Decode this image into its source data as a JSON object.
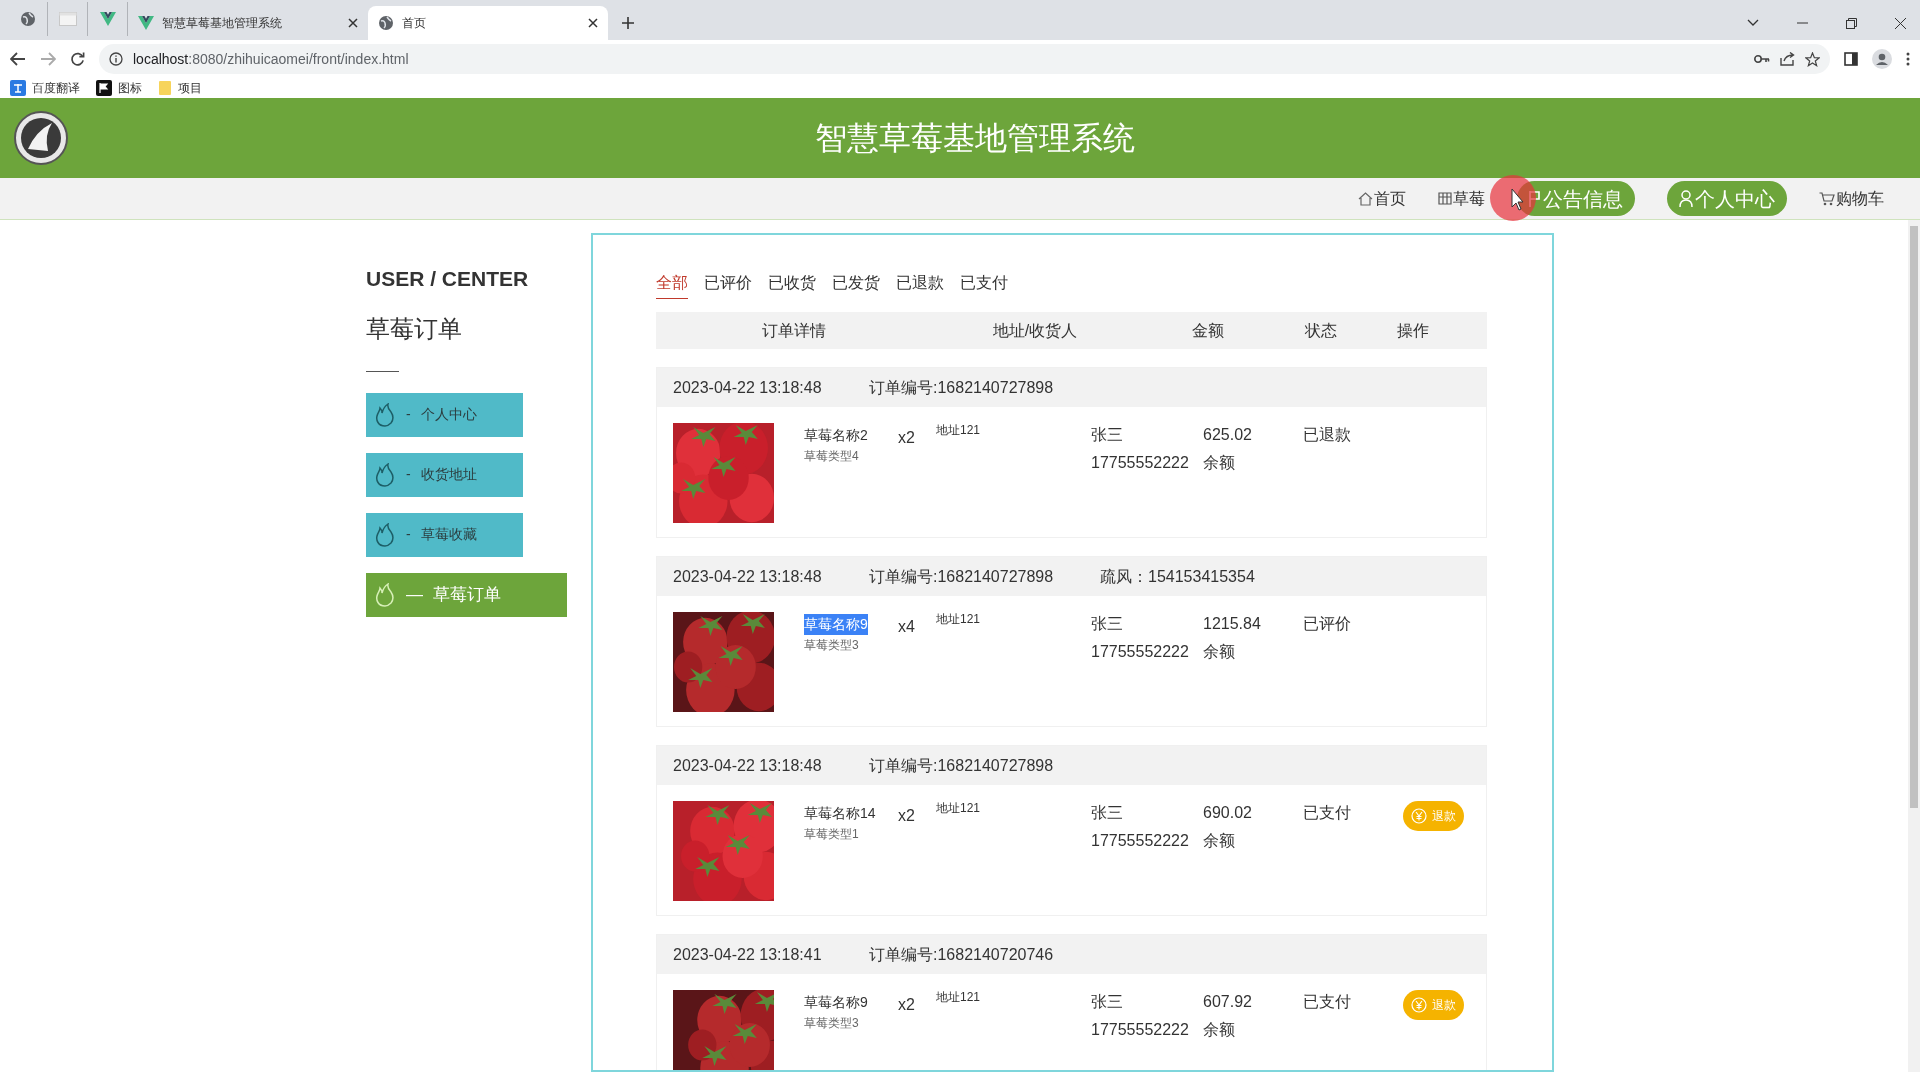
{
  "browser": {
    "tabs": [
      {
        "kind": "icon"
      },
      {
        "kind": "icon"
      },
      {
        "kind": "icon"
      },
      {
        "kind": "page",
        "title": "智慧草莓基地管理系统",
        "selected": false
      },
      {
        "kind": "page",
        "title": "首页",
        "selected": true
      }
    ],
    "url_host": "localhost",
    "url_path": ":8080/zhihuicaomei/front/index.html",
    "bookmarks": [
      "百度翻译",
      "图标",
      "项目"
    ]
  },
  "header": {
    "title": "智慧草莓基地管理系统"
  },
  "nav": [
    {
      "label": "首页",
      "highlighted": false
    },
    {
      "label": "草莓",
      "highlighted": false
    },
    {
      "label": "公告信息",
      "highlighted": true
    },
    {
      "label": "个人中心",
      "highlighted": true
    },
    {
      "label": "购物车",
      "highlighted": false
    }
  ],
  "sidebar": {
    "heading": "USER / CENTER",
    "title": "草莓订单",
    "items": [
      {
        "prefix": "-",
        "label": "个人中心",
        "selected": false
      },
      {
        "prefix": "-",
        "label": "收货地址",
        "selected": false
      },
      {
        "prefix": "-",
        "label": "草莓收藏",
        "selected": false
      },
      {
        "prefix": "—",
        "label": "草莓订单",
        "selected": true
      }
    ]
  },
  "filter_tabs": [
    {
      "label": "全部",
      "selected": true
    },
    {
      "label": "已评价",
      "selected": false
    },
    {
      "label": "已收货",
      "selected": false
    },
    {
      "label": "已发货",
      "selected": false
    },
    {
      "label": "已退款",
      "selected": false
    },
    {
      "label": "已支付",
      "selected": false
    }
  ],
  "columns": [
    "订单详情",
    "地址/收货人",
    "金额",
    "状态",
    "操作"
  ],
  "orders": [
    {
      "time": "2023-04-22 13:18:48",
      "order_no": "订单编号:1682140727898",
      "product": "草莓名称2",
      "highlighted": false,
      "type": "草莓类型4",
      "qty": "x2",
      "address": "地址121",
      "receiver": "张三",
      "phone": "17755552222",
      "amount": "625.02",
      "payment": "余额",
      "status": "已退款"
    },
    {
      "time": "2023-04-22 13:18:48",
      "order_no": "订单编号:1682140727898",
      "extra": "疏风：154153415354",
      "product": "草莓名称9",
      "highlighted": true,
      "type": "草莓类型3",
      "qty": "x4",
      "address": "地址121",
      "receiver": "张三",
      "phone": "17755552222",
      "amount": "1215.84",
      "payment": "余额",
      "status": "已评价"
    },
    {
      "time": "2023-04-22 13:18:48",
      "order_no": "订单编号:1682140727898",
      "product": "草莓名称14",
      "highlighted": false,
      "type": "草莓类型1",
      "qty": "x2",
      "address": "地址121",
      "receiver": "张三",
      "phone": "17755552222",
      "amount": "690.02",
      "payment": "余额",
      "status": "已支付",
      "action": "退款"
    },
    {
      "time": "2023-04-22 13:18:41",
      "order_no": "订单编号:1682140720746",
      "product": "草莓名称9",
      "highlighted": false,
      "type": "草莓类型3",
      "qty": "x2",
      "address": "地址121",
      "receiver": "张三",
      "phone": "17755552222",
      "amount": "607.92",
      "payment": "余额",
      "status": "已支付",
      "action": "退款"
    }
  ]
}
